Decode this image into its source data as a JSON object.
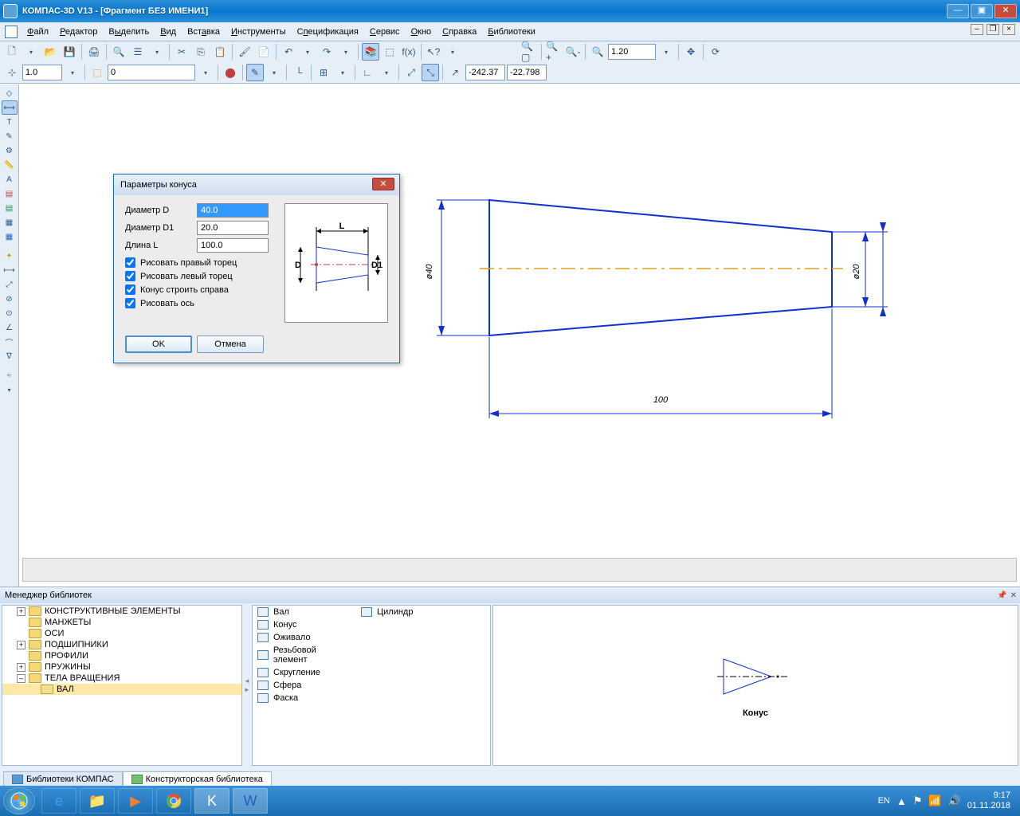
{
  "titlebar": {
    "app": "КОМПАС-3D V13",
    "doc": "[Фрагмент БЕЗ ИМЕНИ1]"
  },
  "menu": {
    "file": "Файл",
    "edit": "Редактор",
    "select": "Выделить",
    "view": "Вид",
    "insert": "Вставка",
    "tools": "Инструменты",
    "spec": "Спецификация",
    "service": "Сервис",
    "window": "Окно",
    "help": "Справка",
    "libs": "Библиотеки"
  },
  "tb2": {
    "scale": "1.0",
    "layer": "0",
    "coord_x": "-242.37",
    "coord_y": "-22.798"
  },
  "zoom": {
    "value": "1.20"
  },
  "drawing": {
    "dimD": "ø40",
    "dimD1": "ø20",
    "dimL": "100"
  },
  "dialog": {
    "title": "Параметры конуса",
    "diamD_label": "Диаметр D",
    "diamD": "40.0",
    "diamD1_label": "Диаметр D1",
    "diamD1": "20.0",
    "lenL_label": "Длина L",
    "lenL": "100.0",
    "chk1": "Рисовать правый торец",
    "chk2": "Рисовать левый торец",
    "chk3": "Конус строить справа",
    "chk4": "Рисовать ось",
    "ok": "OK",
    "cancel": "Отмена",
    "prev_D": "D",
    "prev_D1": "D1",
    "prev_L": "L"
  },
  "libmgr": {
    "title": "Менеджер библиотек",
    "tree": [
      "КОНСТРУКТИВНЫЕ ЭЛЕМЕНТЫ",
      "МАНЖЕТЫ",
      "ОСИ",
      "ПОДШИПНИКИ",
      "ПРОФИЛИ",
      "ПРУЖИНЫ",
      "ТЕЛА ВРАЩЕНИЯ"
    ],
    "tree_sub": "ВАЛ",
    "list_col1": [
      "Вал",
      "Конус",
      "Оживало",
      "Резьбовой элемент",
      "Скругление",
      "Сфера",
      "Фаска"
    ],
    "list_col2": [
      "Цилиндр"
    ],
    "preview_label": "Конус",
    "tab1": "Библиотеки КОМПАС",
    "tab2": "Конструкторская библиотека"
  },
  "taskbar": {
    "lang": "EN",
    "time": "9:17",
    "date": "01.11.2018"
  }
}
